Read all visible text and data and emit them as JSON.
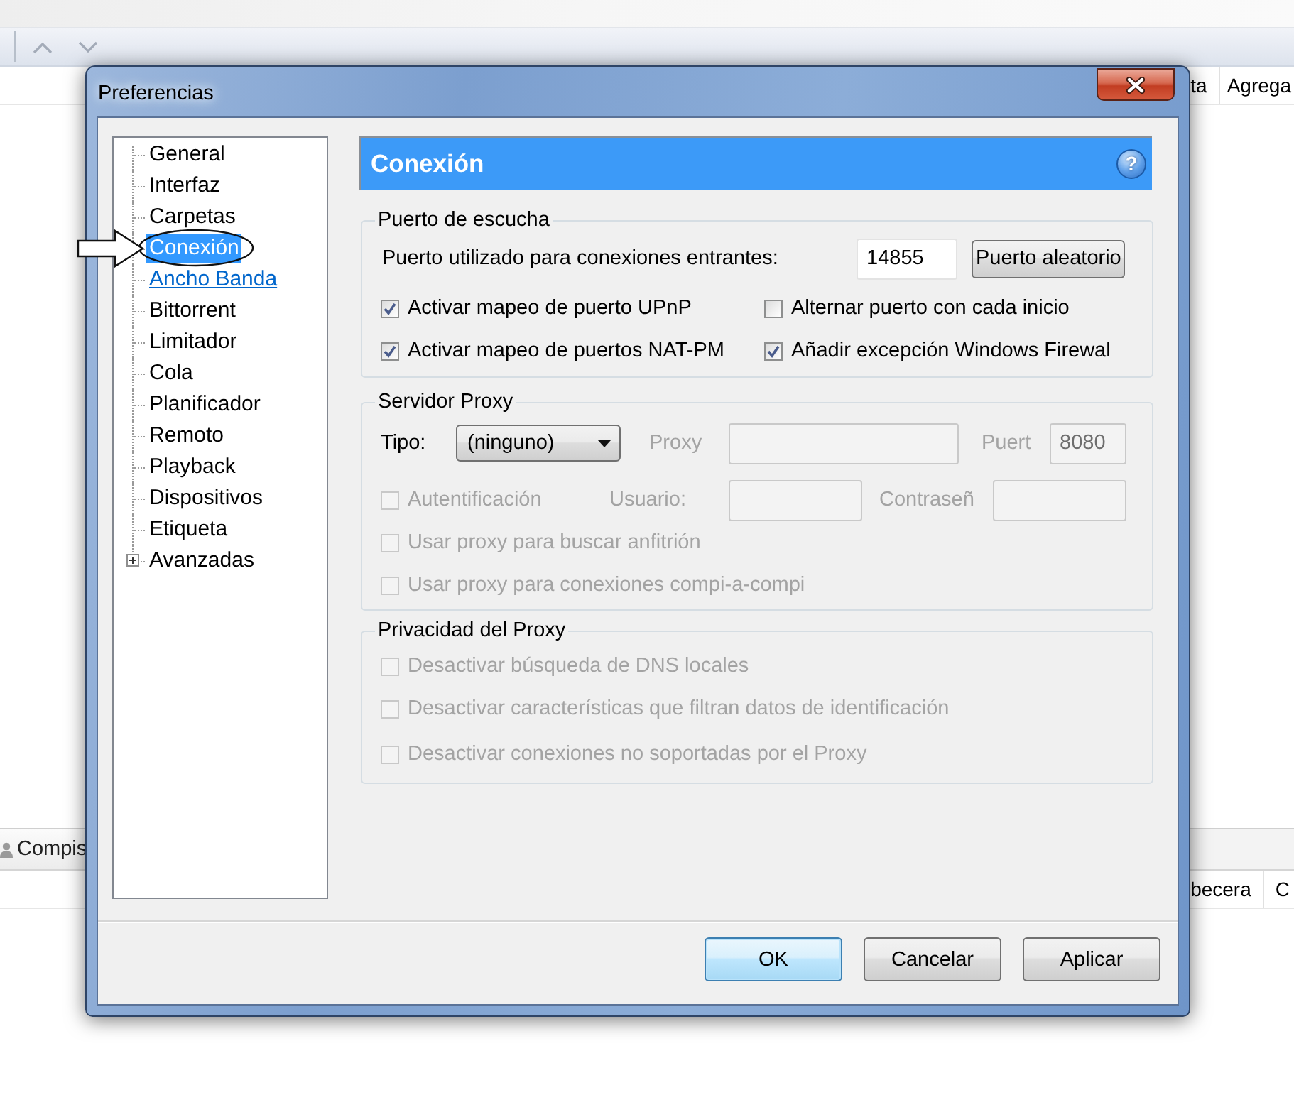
{
  "background_app": {
    "top_header": [
      {
        "label": "ta"
      },
      {
        "label": "Agrega"
      }
    ],
    "tabs": [
      {
        "label": "Compis",
        "selected": true
      }
    ],
    "bottom_header": [
      {
        "label": "becera"
      },
      {
        "label": "C"
      }
    ]
  },
  "window": {
    "title": "Preferencias"
  },
  "sidebar": {
    "items": [
      {
        "label": "General",
        "kind": "leaf",
        "selected": false,
        "hovered": false
      },
      {
        "label": "Interfaz",
        "kind": "leaf",
        "selected": false,
        "hovered": false
      },
      {
        "label": "Carpetas",
        "kind": "leaf",
        "selected": false,
        "hovered": false
      },
      {
        "label": "Conexión",
        "kind": "leaf",
        "selected": true,
        "hovered": false
      },
      {
        "label": "Ancho Banda",
        "kind": "leaf",
        "selected": false,
        "hovered": true
      },
      {
        "label": "Bittorrent",
        "kind": "leaf",
        "selected": false,
        "hovered": false
      },
      {
        "label": "Limitador",
        "kind": "leaf",
        "selected": false,
        "hovered": false
      },
      {
        "label": "Cola",
        "kind": "leaf",
        "selected": false,
        "hovered": false
      },
      {
        "label": "Planificador",
        "kind": "leaf",
        "selected": false,
        "hovered": false
      },
      {
        "label": "Remoto",
        "kind": "leaf",
        "selected": false,
        "hovered": false
      },
      {
        "label": "Playback",
        "kind": "leaf",
        "selected": false,
        "hovered": false
      },
      {
        "label": "Dispositivos",
        "kind": "leaf",
        "selected": false,
        "hovered": false
      },
      {
        "label": "Etiqueta",
        "kind": "leaf",
        "selected": false,
        "hovered": false
      },
      {
        "label": "Avanzadas",
        "kind": "branch",
        "expanded": false,
        "selected": false,
        "hovered": false
      }
    ]
  },
  "panel": {
    "title": "Conexión",
    "help": "?",
    "groups": [
      {
        "title": "Puerto de escucha",
        "rows": [
          {
            "kind": "port",
            "controls": [
              {
                "kind": "label",
                "text": "Puerto utilizado para conexiones entrantes:",
                "disabled": false
              },
              {
                "kind": "field",
                "value": "14855",
                "disabled": false
              },
              {
                "kind": "button",
                "text": "Puerto aleatorio",
                "disabled": false
              }
            ]
          },
          {
            "kind": "pair",
            "controls": [
              {
                "kind": "checkbox",
                "text": "Activar mapeo de puerto UPnP",
                "checked": true,
                "disabled": false
              },
              {
                "kind": "checkbox",
                "text": "Alternar puerto con cada inicio",
                "checked": false,
                "disabled": false
              }
            ]
          },
          {
            "kind": "pair",
            "controls": [
              {
                "kind": "checkbox",
                "text": "Activar mapeo de puertos NAT-PM",
                "checked": true,
                "disabled": false
              },
              {
                "kind": "checkbox",
                "text": "Añadir excepción Windows Firewal",
                "checked": true,
                "disabled": false
              }
            ]
          }
        ]
      },
      {
        "title": "Servidor Proxy",
        "rows": [
          {
            "kind": "proxy",
            "controls": [
              {
                "kind": "label",
                "text": "Tipo:",
                "disabled": false
              },
              {
                "kind": "select",
                "value": "(ninguno)",
                "disabled": false
              },
              {
                "kind": "label",
                "text": "Proxy",
                "disabled": true
              },
              {
                "kind": "field",
                "disabled": true
              },
              {
                "kind": "label",
                "text": "Puert",
                "disabled": true
              },
              {
                "kind": "field",
                "value": "8080",
                "disabled": true
              }
            ]
          },
          {
            "kind": "auth",
            "controls": [
              {
                "kind": "checkbox",
                "text": "Autentificación",
                "checked": false,
                "disabled": true
              },
              {
                "kind": "label",
                "text": "Usuario:",
                "disabled": true
              },
              {
                "kind": "field",
                "disabled": true
              },
              {
                "kind": "label",
                "text": "Contraseñ",
                "disabled": true
              },
              {
                "kind": "field",
                "disabled": true
              }
            ]
          },
          {
            "kind": "single",
            "controls": [
              {
                "kind": "checkbox",
                "text": "Usar proxy para buscar anfitrión",
                "checked": false,
                "disabled": true
              }
            ]
          },
          {
            "kind": "single",
            "controls": [
              {
                "kind": "checkbox",
                "text": "Usar proxy para conexiones compi-a-compi",
                "checked": false,
                "disabled": true
              }
            ]
          }
        ]
      },
      {
        "title": "Privacidad del Proxy",
        "rows": [
          {
            "kind": "single",
            "controls": [
              {
                "kind": "checkbox",
                "text": "Desactivar búsqueda de DNS locales",
                "checked": false,
                "disabled": true
              }
            ]
          },
          {
            "kind": "single",
            "controls": [
              {
                "kind": "checkbox",
                "text": "Desactivar características que filtran datos de identificación",
                "checked": false,
                "disabled": true
              }
            ]
          },
          {
            "kind": "single",
            "controls": [
              {
                "kind": "checkbox",
                "text": "Desactivar conexiones no soportadas por el Proxy",
                "checked": false,
                "disabled": true
              }
            ]
          }
        ]
      }
    ]
  },
  "buttons": [
    {
      "label": "OK",
      "default": true
    },
    {
      "label": "Cancelar",
      "default": false
    },
    {
      "label": "Aplicar",
      "default": false
    }
  ]
}
